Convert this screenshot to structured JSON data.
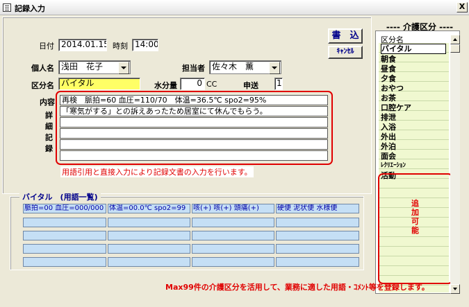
{
  "window": {
    "title": "記録入力",
    "close_glyph": "X"
  },
  "form": {
    "date_label": "日付",
    "date_value": "2014.01.15",
    "time_label": "時刻",
    "time_value": "14:00",
    "person_label": "個人名",
    "person_value": "浅田　花子",
    "staff_label": "担当者",
    "staff_value": "佐々木　薫",
    "category_label": "区分名",
    "category_value": "バイタル",
    "water_label": "水分量",
    "water_value": "0",
    "water_unit": "CC",
    "handover_label": "申送",
    "handover_value": "1",
    "content_label": "内容",
    "detail_label_chars": [
      "詳",
      "細",
      "記",
      "録"
    ],
    "content_lines": [
      "再検　脈拍=60 血圧=110/70　体温=36.5℃ spo2=95%",
      "「寒気がする」との訴えあったため居室にて休んでもらう。",
      "",
      "",
      "",
      ""
    ],
    "note": "用語引用と直接入力により記録文書の入力を行います。"
  },
  "buttons": {
    "write": "書　込",
    "cancel": "ｷｬﾝｾﾙ"
  },
  "vital": {
    "title": "バイタル　(用語一覧)",
    "rows": [
      [
        "脈拍=00 血圧=000/000",
        "体温=00.0℃ spo2=99",
        "咳(+) 咳(+) 頭痛(+)",
        "硬便 泥状便 水様便"
      ],
      [
        "",
        "",
        "",
        ""
      ],
      [
        "",
        "",
        "",
        ""
      ],
      [
        "",
        "",
        "",
        ""
      ],
      [
        "",
        "",
        "",
        ""
      ]
    ]
  },
  "care": {
    "title": "---- 介護区分 ----",
    "header": "区分名",
    "items": [
      "バイタル",
      "朝食",
      "昼食",
      "夕食",
      "おやつ",
      "お茶",
      "口腔ケア",
      "排泄",
      "入浴",
      "外出",
      "外泊",
      "面会",
      "ﾚｸﾘｴｰｼｮﾝ",
      "活動"
    ],
    "addable_chars": [
      "追",
      "加",
      "可",
      "能"
    ]
  },
  "footer_note": "Max99件の介護区分を活用して、業務に適した用語・ｺﾒﾝﾄ等を登録します。",
  "colors": {
    "accent_red": "#e00000",
    "highlight_yellow": "#ffff66",
    "vital_cell": "#c5dff5",
    "care_line": "#f0f8d0"
  }
}
